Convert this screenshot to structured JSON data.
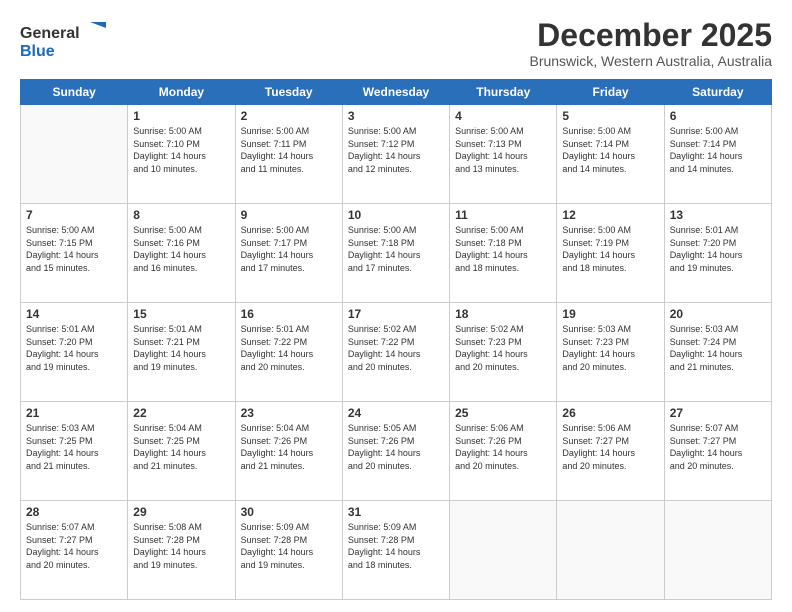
{
  "header": {
    "logo": {
      "line1": "General",
      "line2": "Blue"
    },
    "title": "December 2025",
    "subtitle": "Brunswick, Western Australia, Australia"
  },
  "weekdays": [
    "Sunday",
    "Monday",
    "Tuesday",
    "Wednesday",
    "Thursday",
    "Friday",
    "Saturday"
  ],
  "weeks": [
    [
      {
        "day": "",
        "info": ""
      },
      {
        "day": "1",
        "info": "Sunrise: 5:00 AM\nSunset: 7:10 PM\nDaylight: 14 hours\nand 10 minutes."
      },
      {
        "day": "2",
        "info": "Sunrise: 5:00 AM\nSunset: 7:11 PM\nDaylight: 14 hours\nand 11 minutes."
      },
      {
        "day": "3",
        "info": "Sunrise: 5:00 AM\nSunset: 7:12 PM\nDaylight: 14 hours\nand 12 minutes."
      },
      {
        "day": "4",
        "info": "Sunrise: 5:00 AM\nSunset: 7:13 PM\nDaylight: 14 hours\nand 13 minutes."
      },
      {
        "day": "5",
        "info": "Sunrise: 5:00 AM\nSunset: 7:14 PM\nDaylight: 14 hours\nand 14 minutes."
      },
      {
        "day": "6",
        "info": "Sunrise: 5:00 AM\nSunset: 7:14 PM\nDaylight: 14 hours\nand 14 minutes."
      }
    ],
    [
      {
        "day": "7",
        "info": "Sunrise: 5:00 AM\nSunset: 7:15 PM\nDaylight: 14 hours\nand 15 minutes."
      },
      {
        "day": "8",
        "info": "Sunrise: 5:00 AM\nSunset: 7:16 PM\nDaylight: 14 hours\nand 16 minutes."
      },
      {
        "day": "9",
        "info": "Sunrise: 5:00 AM\nSunset: 7:17 PM\nDaylight: 14 hours\nand 17 minutes."
      },
      {
        "day": "10",
        "info": "Sunrise: 5:00 AM\nSunset: 7:18 PM\nDaylight: 14 hours\nand 17 minutes."
      },
      {
        "day": "11",
        "info": "Sunrise: 5:00 AM\nSunset: 7:18 PM\nDaylight: 14 hours\nand 18 minutes."
      },
      {
        "day": "12",
        "info": "Sunrise: 5:00 AM\nSunset: 7:19 PM\nDaylight: 14 hours\nand 18 minutes."
      },
      {
        "day": "13",
        "info": "Sunrise: 5:01 AM\nSunset: 7:20 PM\nDaylight: 14 hours\nand 19 minutes."
      }
    ],
    [
      {
        "day": "14",
        "info": "Sunrise: 5:01 AM\nSunset: 7:20 PM\nDaylight: 14 hours\nand 19 minutes."
      },
      {
        "day": "15",
        "info": "Sunrise: 5:01 AM\nSunset: 7:21 PM\nDaylight: 14 hours\nand 19 minutes."
      },
      {
        "day": "16",
        "info": "Sunrise: 5:01 AM\nSunset: 7:22 PM\nDaylight: 14 hours\nand 20 minutes."
      },
      {
        "day": "17",
        "info": "Sunrise: 5:02 AM\nSunset: 7:22 PM\nDaylight: 14 hours\nand 20 minutes."
      },
      {
        "day": "18",
        "info": "Sunrise: 5:02 AM\nSunset: 7:23 PM\nDaylight: 14 hours\nand 20 minutes."
      },
      {
        "day": "19",
        "info": "Sunrise: 5:03 AM\nSunset: 7:23 PM\nDaylight: 14 hours\nand 20 minutes."
      },
      {
        "day": "20",
        "info": "Sunrise: 5:03 AM\nSunset: 7:24 PM\nDaylight: 14 hours\nand 21 minutes."
      }
    ],
    [
      {
        "day": "21",
        "info": "Sunrise: 5:03 AM\nSunset: 7:25 PM\nDaylight: 14 hours\nand 21 minutes."
      },
      {
        "day": "22",
        "info": "Sunrise: 5:04 AM\nSunset: 7:25 PM\nDaylight: 14 hours\nand 21 minutes."
      },
      {
        "day": "23",
        "info": "Sunrise: 5:04 AM\nSunset: 7:26 PM\nDaylight: 14 hours\nand 21 minutes."
      },
      {
        "day": "24",
        "info": "Sunrise: 5:05 AM\nSunset: 7:26 PM\nDaylight: 14 hours\nand 20 minutes."
      },
      {
        "day": "25",
        "info": "Sunrise: 5:06 AM\nSunset: 7:26 PM\nDaylight: 14 hours\nand 20 minutes."
      },
      {
        "day": "26",
        "info": "Sunrise: 5:06 AM\nSunset: 7:27 PM\nDaylight: 14 hours\nand 20 minutes."
      },
      {
        "day": "27",
        "info": "Sunrise: 5:07 AM\nSunset: 7:27 PM\nDaylight: 14 hours\nand 20 minutes."
      }
    ],
    [
      {
        "day": "28",
        "info": "Sunrise: 5:07 AM\nSunset: 7:27 PM\nDaylight: 14 hours\nand 20 minutes."
      },
      {
        "day": "29",
        "info": "Sunrise: 5:08 AM\nSunset: 7:28 PM\nDaylight: 14 hours\nand 19 minutes."
      },
      {
        "day": "30",
        "info": "Sunrise: 5:09 AM\nSunset: 7:28 PM\nDaylight: 14 hours\nand 19 minutes."
      },
      {
        "day": "31",
        "info": "Sunrise: 5:09 AM\nSunset: 7:28 PM\nDaylight: 14 hours\nand 18 minutes."
      },
      {
        "day": "",
        "info": ""
      },
      {
        "day": "",
        "info": ""
      },
      {
        "day": "",
        "info": ""
      }
    ]
  ]
}
